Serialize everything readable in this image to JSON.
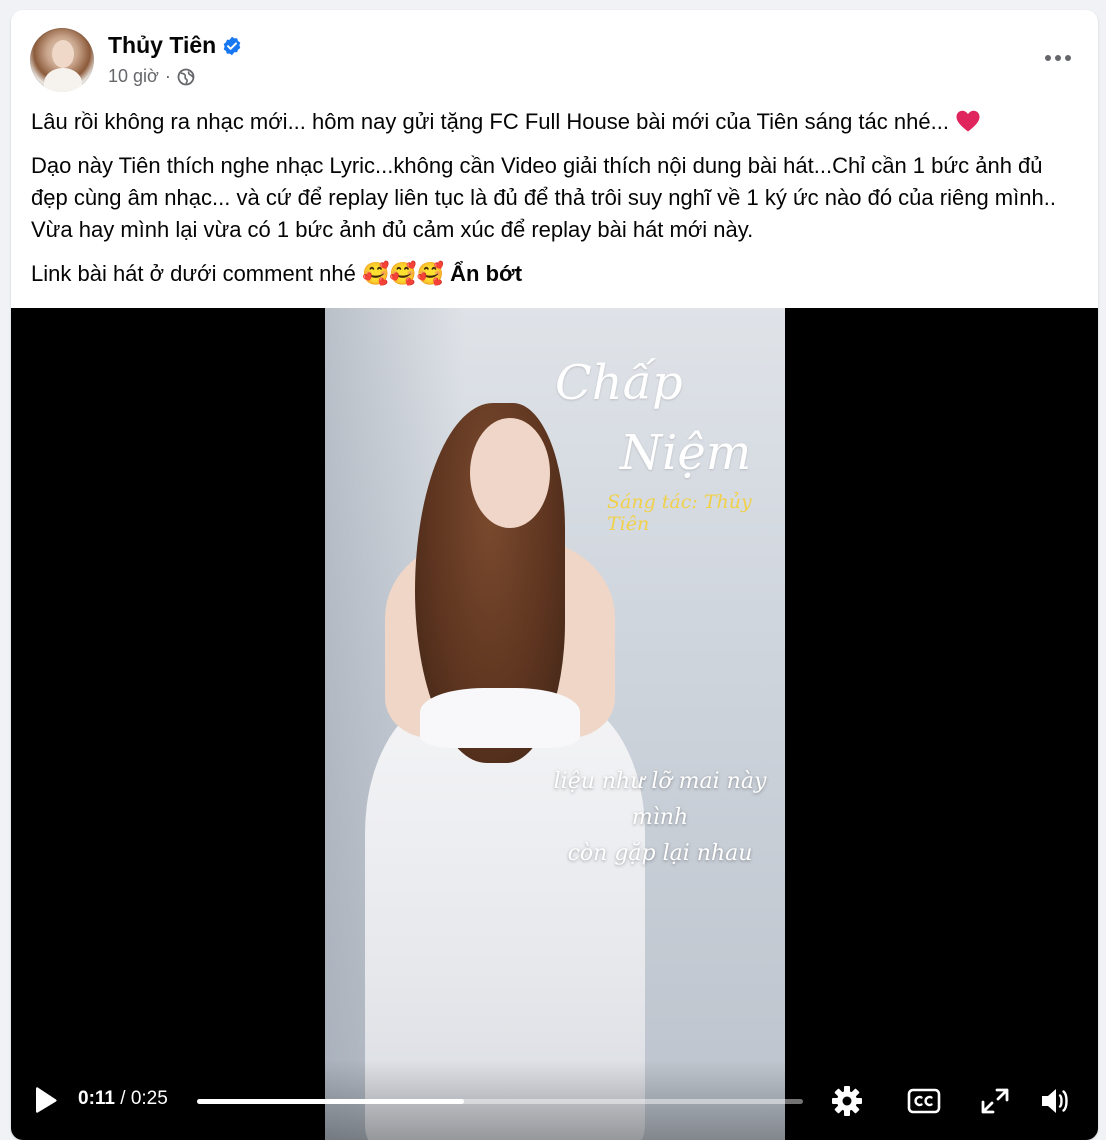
{
  "post": {
    "author": "Thủy Tiên",
    "time": "10 giờ",
    "separator": "·",
    "paragraphs": [
      "Lâu rồi không ra nhạc mới... hôm nay gửi tặng FC Full House bài mới của Tiên sáng tác nhé...",
      "Dạo này Tiên thích nghe nhạc Lyric...không cần Video giải thích nội dung bài hát...Chỉ cần 1 bức ảnh đủ đẹp cùng âm nhạc... và cứ để replay liên tục là đủ để thả trôi suy nghĩ về 1 ký ức nào đó của riêng mình.. Vừa hay mình lại vừa có 1 bức ảnh đủ cảm xúc để replay bài hát mới này.",
      "Link bài hát ở dưới comment nhé"
    ],
    "emojis": "🥰🥰🥰",
    "see_less": "Ẩn bớt"
  },
  "video": {
    "title_line1": "Chấp",
    "title_line2": "Niệm",
    "composer": "Sáng tác: Thủy Tiên",
    "lyric_line1": "liệu như lỡ mai này mình",
    "lyric_line2": "còn gặp lại nhau",
    "current_time": "0:11",
    "time_separator": "/",
    "duration": "0:25",
    "progress": 0.44
  },
  "icons": {
    "verified": "verified-badge-icon",
    "privacy": "globe-icon",
    "more": "more-options-icon",
    "heart": "red-heart-icon",
    "play": "play-icon",
    "settings": "gear-icon",
    "captions": "cc-icon",
    "fullscreen": "expand-icon",
    "volume": "speaker-icon"
  },
  "colors": {
    "verified": "#1877f2",
    "heart": "#e0245e",
    "composer": "#f1d04a"
  }
}
